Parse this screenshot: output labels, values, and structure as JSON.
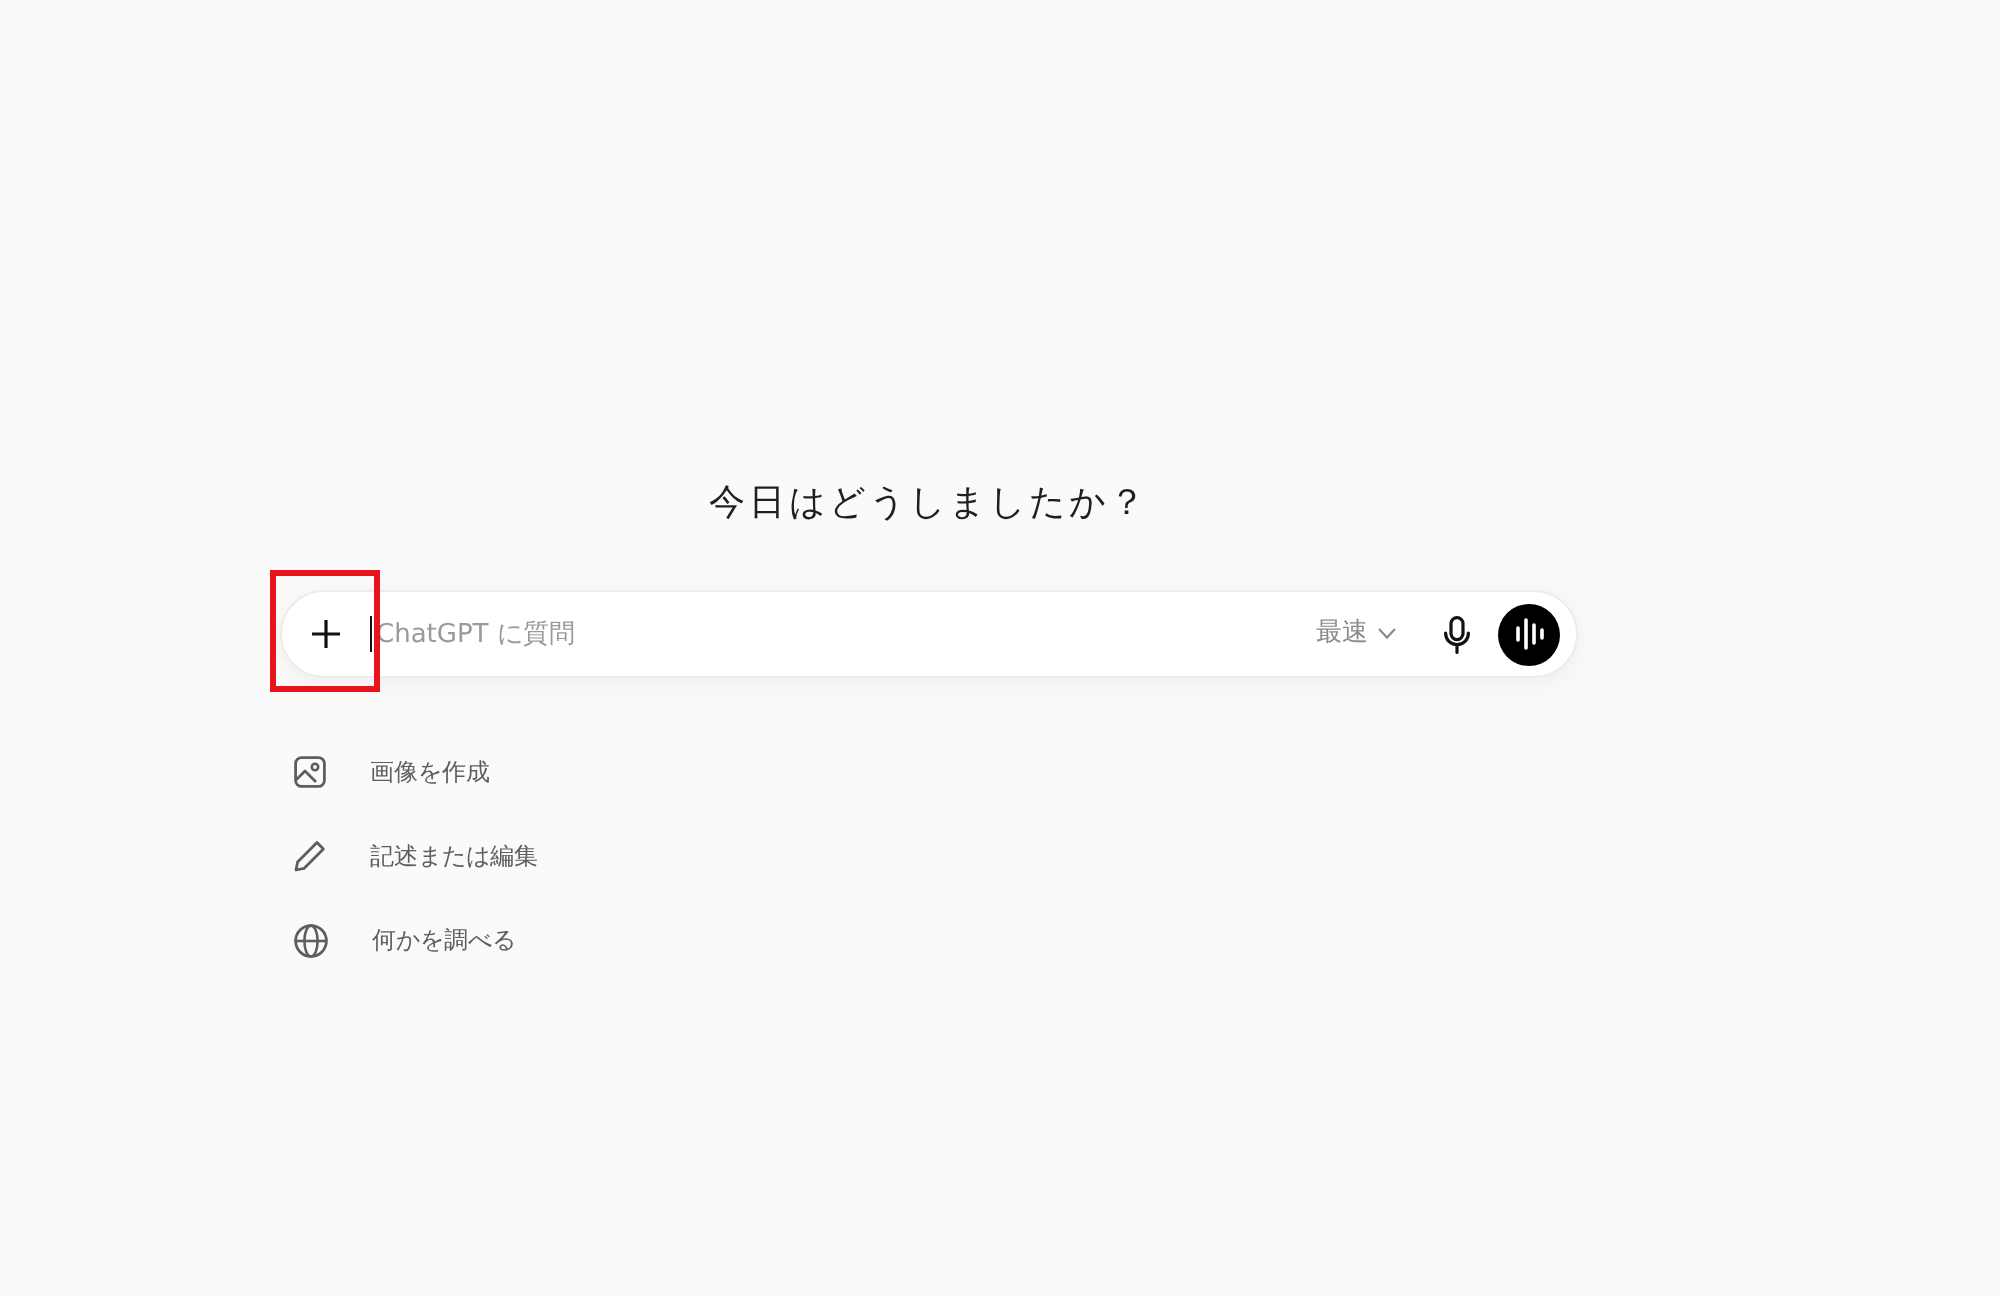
{
  "heading": "今日はどうしましたか？",
  "composer": {
    "placeholder": "ChatGPT に質問",
    "focused": true,
    "model": "最速"
  },
  "suggestions": [
    {
      "label": "画像を作成",
      "kind": "image"
    },
    {
      "label": "記述または編集",
      "kind": "pencil"
    },
    {
      "label": "何かを調べる",
      "kind": "globe"
    }
  ],
  "annotations": [
    {
      "kind": "highlight-box"
    }
  ]
}
